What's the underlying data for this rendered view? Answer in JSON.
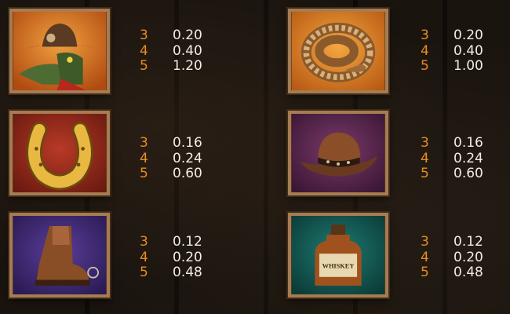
{
  "paytable": [
    {
      "symbol": "alligator-cowboy",
      "icon": "alligator-cowboy-icon",
      "payouts": [
        {
          "count": "3",
          "value": "0.20"
        },
        {
          "count": "4",
          "value": "0.40"
        },
        {
          "count": "5",
          "value": "1.20"
        }
      ]
    },
    {
      "symbol": "rattlesnake",
      "icon": "rattlesnake-icon",
      "payouts": [
        {
          "count": "3",
          "value": "0.20"
        },
        {
          "count": "4",
          "value": "0.40"
        },
        {
          "count": "5",
          "value": "1.00"
        }
      ]
    },
    {
      "symbol": "horseshoe",
      "icon": "horseshoe-icon",
      "payouts": [
        {
          "count": "3",
          "value": "0.16"
        },
        {
          "count": "4",
          "value": "0.24"
        },
        {
          "count": "5",
          "value": "0.60"
        }
      ]
    },
    {
      "symbol": "cowboy-hat",
      "icon": "cowboy-hat-icon",
      "payouts": [
        {
          "count": "3",
          "value": "0.16"
        },
        {
          "count": "4",
          "value": "0.24"
        },
        {
          "count": "5",
          "value": "0.60"
        }
      ]
    },
    {
      "symbol": "cowboy-boot",
      "icon": "cowboy-boot-icon",
      "payouts": [
        {
          "count": "3",
          "value": "0.12"
        },
        {
          "count": "4",
          "value": "0.20"
        },
        {
          "count": "5",
          "value": "0.48"
        }
      ]
    },
    {
      "symbol": "whiskey-bottle",
      "icon": "whiskey-bottle-icon",
      "payouts": [
        {
          "count": "3",
          "value": "0.12"
        },
        {
          "count": "4",
          "value": "0.20"
        },
        {
          "count": "5",
          "value": "0.48"
        }
      ],
      "label_text": "WHISKEY"
    }
  ],
  "colors": {
    "count": "#e88c22",
    "value": "#f2ece4",
    "frame": "#a67c52"
  }
}
